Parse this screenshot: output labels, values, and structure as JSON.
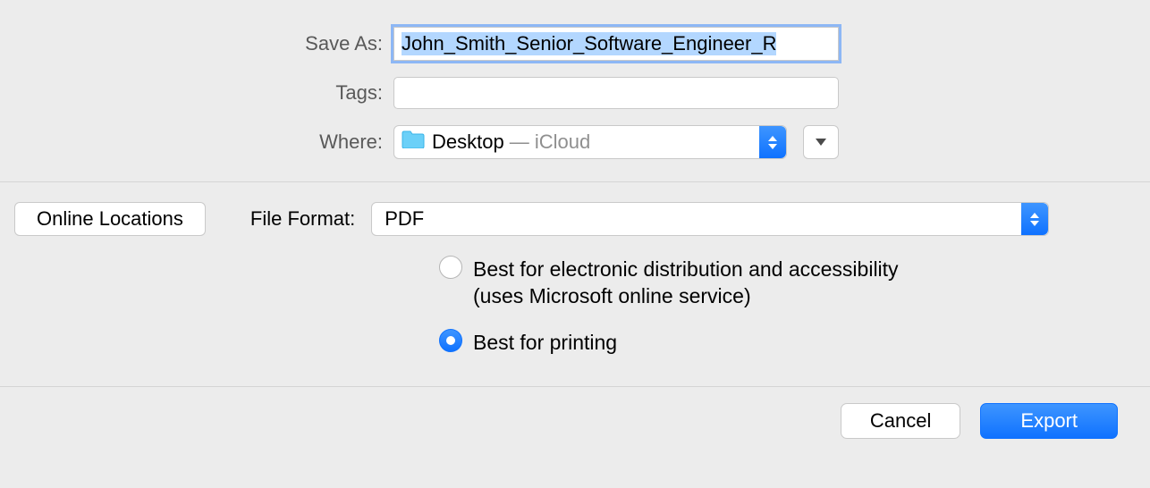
{
  "labels": {
    "save_as": "Save As:",
    "tags": "Tags:",
    "where": "Where:",
    "file_format": "File Format:"
  },
  "save_as": {
    "value": "John_Smith_Senior_Software_Engineer_R"
  },
  "tags": {
    "value": ""
  },
  "where": {
    "folder": "Desktop",
    "suffix": "— iCloud"
  },
  "online_locations_label": "Online Locations",
  "file_format": {
    "value": "PDF"
  },
  "options": [
    {
      "line1": "Best for electronic distribution and accessibility",
      "line2": "(uses Microsoft online service)",
      "checked": false
    },
    {
      "line1": "Best for printing",
      "line2": "",
      "checked": true
    }
  ],
  "buttons": {
    "cancel": "Cancel",
    "export": "Export"
  }
}
